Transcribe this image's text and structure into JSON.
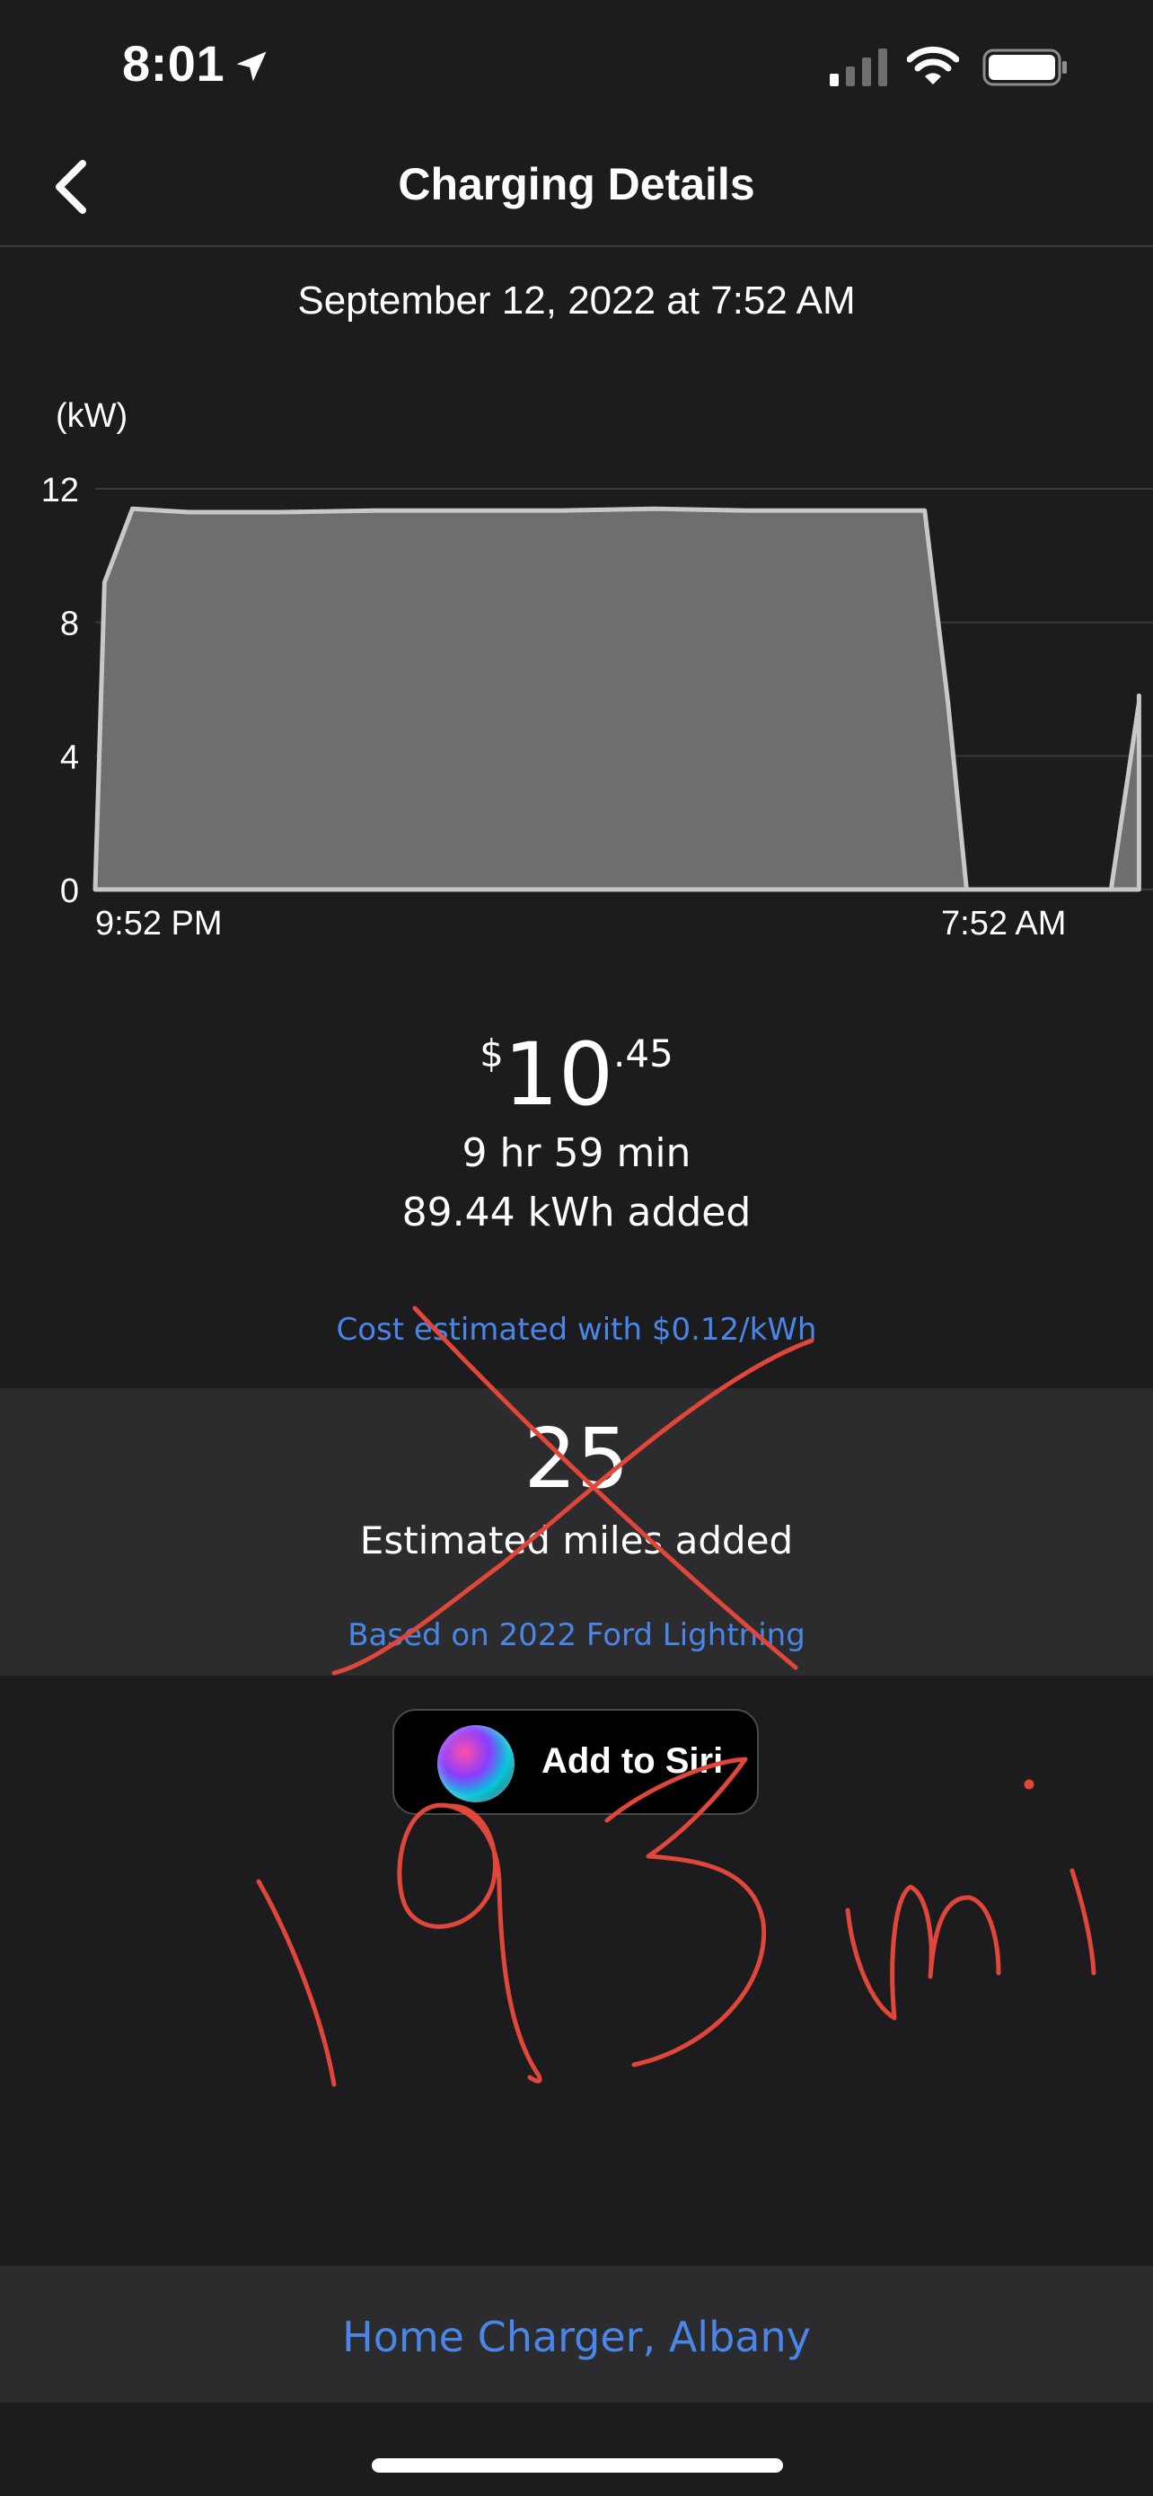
{
  "status_bar": {
    "time": "8:01",
    "location_icon": "location-arrow-icon",
    "signal_icon": "cellular-signal-icon",
    "wifi_icon": "wifi-icon",
    "battery_icon": "battery-icon"
  },
  "nav": {
    "back_icon": "chevron-left-icon",
    "title": "Charging Details"
  },
  "session": {
    "date": "September 12, 2022 at 7:52 AM",
    "price_symbol": "$",
    "price_whole": "10",
    "price_cents": ".45",
    "duration": "9 hr 59 min",
    "energy": "89.44 kWh added",
    "cost_note": "Cost estimated with $0.12/kWh"
  },
  "chart_data": {
    "type": "area",
    "title": "",
    "xlabel": "",
    "ylabel": "(kW)",
    "ylim": [
      0,
      12
    ],
    "yticks": [
      "0",
      "4",
      "8",
      "12"
    ],
    "xtick_labels": [
      "9:52 PM",
      "7:52 AM"
    ],
    "grid": true,
    "x_hours_after_start": [
      0,
      0.1,
      0.4,
      1,
      2,
      3,
      4,
      5,
      6,
      7,
      8,
      8.9,
      9.15,
      9.35,
      10.0,
      10.9,
      11.2,
      11.2
    ],
    "values": [
      0,
      9.2,
      11.4,
      11.3,
      11.3,
      11.35,
      11.35,
      11.35,
      11.4,
      11.35,
      11.35,
      11.35,
      5.6,
      0,
      0,
      0,
      5.6,
      5.8
    ],
    "colors": {
      "fill": "#6e6e70",
      "line": "#c8c8c8",
      "grid": "#3a3a3c"
    }
  },
  "miles": {
    "value": "25",
    "label": "Estimated miles added",
    "vehicle_note": "Based on 2022 Ford Lightning"
  },
  "siri": {
    "label": "Add to Siri",
    "icon": "siri-orb-icon"
  },
  "annotation": {
    "handwritten_text": "193mi",
    "color": "#e0463a"
  },
  "footer": {
    "charger": "Home Charger, Albany"
  },
  "colors": {
    "background": "#1c1c1e",
    "panel": "#2c2c2e",
    "link": "#4a86e8"
  }
}
